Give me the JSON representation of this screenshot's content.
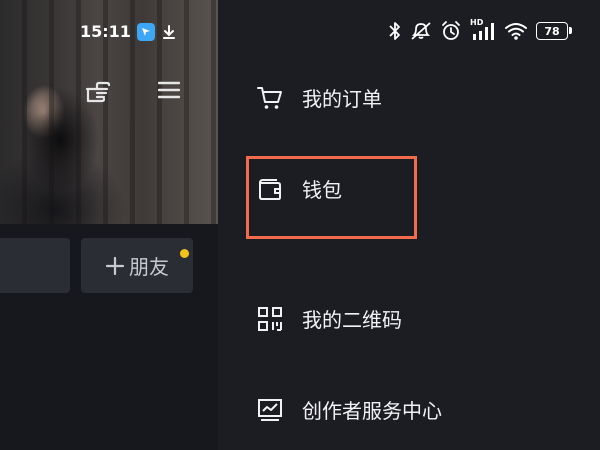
{
  "status_bar": {
    "time": "15:11",
    "battery": "78",
    "signal_label": "HD"
  },
  "profile": {
    "add_friend_label": "朋友"
  },
  "drawer": {
    "items": [
      {
        "label": "我的订单",
        "icon": "cart-icon"
      },
      {
        "label": "钱包",
        "icon": "wallet-icon"
      },
      {
        "label": "我的二维码",
        "icon": "qr-code-icon"
      },
      {
        "label": "创作者服务中心",
        "icon": "creator-chart-icon"
      }
    ]
  },
  "colors": {
    "drawer_bg": "#1c1d23",
    "highlight": "#f26b4c",
    "notify_dot": "#f1c21b",
    "app_badge": "#3ea7f5"
  }
}
